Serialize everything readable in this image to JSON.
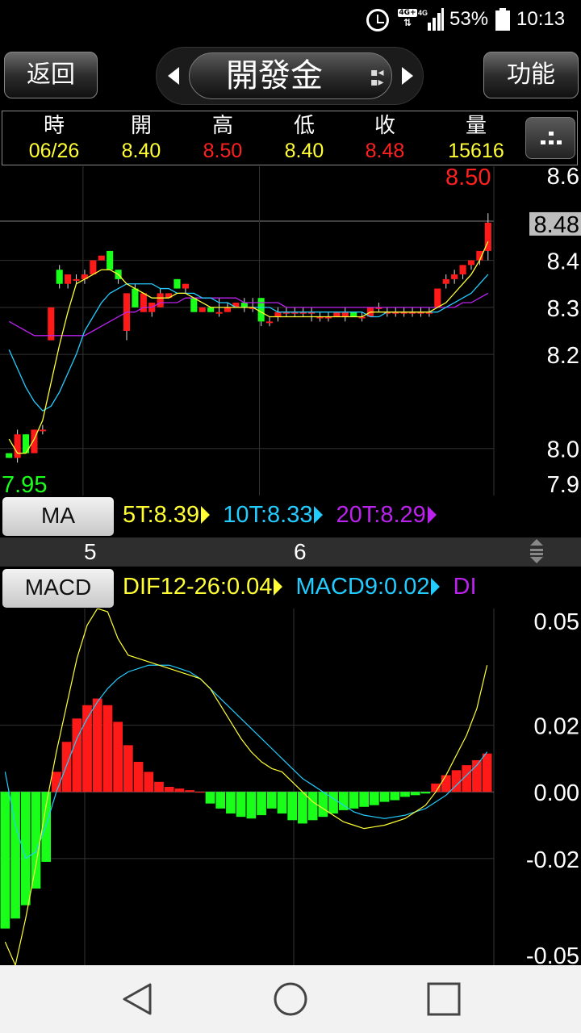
{
  "status_bar": {
    "network": "4G+",
    "network2": "4G",
    "battery": "53%",
    "time": "10:13",
    "icons": [
      "alarm-icon",
      "network-4g-icon",
      "signal-icon",
      "battery-icon"
    ]
  },
  "header": {
    "back_label": "返回",
    "title": "開發金",
    "function_label": "功能"
  },
  "quote": {
    "columns": [
      {
        "label": "時",
        "value": "06/26",
        "color": "#ffff33"
      },
      {
        "label": "開",
        "value": "8.40",
        "color": "#ffff33"
      },
      {
        "label": "高",
        "value": "8.50",
        "color": "#ff2020"
      },
      {
        "label": "低",
        "value": "8.40",
        "color": "#ffff33"
      },
      {
        "label": "收",
        "value": "8.48",
        "color": "#ff2020"
      },
      {
        "label": "量",
        "value": "15616",
        "color": "#ffff33"
      }
    ]
  },
  "ma_panel": {
    "button_label": "MA",
    "legend": [
      {
        "text": "5T:8.39",
        "color": "#ffff33"
      },
      {
        "text": "10T:8.33",
        "color": "#22ccff"
      },
      {
        "text": "20T:8.29",
        "color": "#bb22ee"
      }
    ]
  },
  "macd_panel": {
    "button_label": "MACD",
    "legend": [
      {
        "text": "DIF12-26:0.04",
        "color": "#ffff33"
      },
      {
        "text": "MACD9:0.02",
        "color": "#22ccff"
      },
      {
        "text": "DI",
        "color": "#bb22ee"
      }
    ]
  },
  "axis_dates": [
    "5",
    "6"
  ],
  "colors": {
    "up": "#ff1a1a",
    "down": "#1aff1a",
    "ma5": "#ffff33",
    "ma10": "#22ccff",
    "ma20": "#bb22ee"
  },
  "chart_data": [
    {
      "type": "candlestick",
      "title": "",
      "high_label": "8.50",
      "low_label": "7.95",
      "last_label": "8.48",
      "y_tick_labels": [
        "8.6",
        "8.4",
        "8.3",
        "8.2",
        "8.0",
        "7.9"
      ],
      "y_tick_values": [
        8.6,
        8.4,
        8.3,
        8.2,
        8.0,
        7.9
      ],
      "ylim": [
        7.9,
        8.6
      ],
      "x_labels": [
        "5",
        "6"
      ],
      "x_label_index": [
        8,
        29
      ],
      "candles": [
        [
          7.99,
          7.99,
          7.98,
          7.98
        ],
        [
          7.98,
          8.04,
          7.97,
          8.03
        ],
        [
          8.03,
          8.03,
          7.99,
          7.99
        ],
        [
          7.99,
          8.04,
          7.99,
          8.04
        ],
        [
          8.04,
          8.05,
          8.03,
          8.04
        ],
        [
          8.23,
          8.3,
          8.23,
          8.3
        ],
        [
          8.38,
          8.39,
          8.34,
          8.35
        ],
        [
          8.35,
          8.37,
          8.34,
          8.37
        ],
        [
          8.36,
          8.37,
          8.35,
          8.36
        ],
        [
          8.36,
          8.38,
          8.35,
          8.37
        ],
        [
          8.37,
          8.4,
          8.37,
          8.4
        ],
        [
          8.4,
          8.41,
          8.4,
          8.41
        ],
        [
          8.42,
          8.42,
          8.38,
          8.38
        ],
        [
          8.38,
          8.38,
          8.35,
          8.36
        ],
        [
          8.25,
          8.33,
          8.23,
          8.33
        ],
        [
          8.34,
          8.35,
          8.3,
          8.3
        ],
        [
          8.29,
          8.33,
          8.29,
          8.33
        ],
        [
          8.29,
          8.31,
          8.28,
          8.31
        ],
        [
          8.3,
          8.34,
          8.3,
          8.33
        ],
        [
          8.32,
          8.33,
          8.32,
          8.33
        ],
        [
          8.36,
          8.36,
          8.34,
          8.34
        ],
        [
          8.34,
          8.35,
          8.33,
          8.35
        ],
        [
          8.32,
          8.32,
          8.29,
          8.29
        ],
        [
          8.29,
          8.3,
          8.29,
          8.3
        ],
        [
          8.3,
          8.3,
          8.29,
          8.29
        ],
        [
          8.29,
          8.32,
          8.28,
          8.29
        ],
        [
          8.29,
          8.31,
          8.29,
          8.3
        ],
        [
          8.3,
          8.31,
          8.3,
          8.31
        ],
        [
          8.31,
          8.32,
          8.29,
          8.3
        ],
        [
          8.3,
          8.32,
          8.29,
          8.3
        ],
        [
          8.32,
          8.32,
          8.26,
          8.27
        ],
        [
          8.27,
          8.28,
          8.26,
          8.27
        ],
        [
          8.28,
          8.3,
          8.27,
          8.29
        ],
        [
          8.29,
          8.3,
          8.28,
          8.29
        ],
        [
          8.29,
          8.3,
          8.28,
          8.29
        ],
        [
          8.29,
          8.3,
          8.28,
          8.29
        ],
        [
          8.29,
          8.3,
          8.27,
          8.29
        ],
        [
          8.28,
          8.29,
          8.27,
          8.28
        ],
        [
          8.28,
          8.29,
          8.27,
          8.28
        ],
        [
          8.28,
          8.29,
          8.28,
          8.29
        ],
        [
          8.28,
          8.3,
          8.27,
          8.29
        ],
        [
          8.29,
          8.29,
          8.28,
          8.28
        ],
        [
          8.28,
          8.29,
          8.27,
          8.28
        ],
        [
          8.28,
          8.3,
          8.28,
          8.3
        ],
        [
          8.3,
          8.31,
          8.29,
          8.3
        ],
        [
          8.29,
          8.3,
          8.28,
          8.29
        ],
        [
          8.29,
          8.3,
          8.28,
          8.29
        ],
        [
          8.29,
          8.3,
          8.28,
          8.29
        ],
        [
          8.29,
          8.3,
          8.28,
          8.29
        ],
        [
          8.29,
          8.3,
          8.28,
          8.29
        ],
        [
          8.29,
          8.3,
          8.28,
          8.29
        ],
        [
          8.3,
          8.34,
          8.3,
          8.34
        ],
        [
          8.35,
          8.37,
          8.34,
          8.36
        ],
        [
          8.36,
          8.38,
          8.35,
          8.37
        ],
        [
          8.37,
          8.39,
          8.36,
          8.39
        ],
        [
          8.39,
          8.4,
          8.38,
          8.4
        ],
        [
          8.4,
          8.41,
          8.39,
          8.42
        ],
        [
          8.42,
          8.5,
          8.4,
          8.48
        ]
      ],
      "ma5": [
        8.02,
        7.99,
        7.99,
        8.02,
        8.06,
        8.14,
        8.22,
        8.29,
        8.35,
        8.36,
        8.37,
        8.38,
        8.38,
        8.37,
        8.35,
        8.34,
        8.33,
        8.32,
        8.32,
        8.32,
        8.33,
        8.33,
        8.32,
        8.31,
        8.3,
        8.3,
        8.3,
        8.3,
        8.3,
        8.3,
        8.29,
        8.28,
        8.28,
        8.28,
        8.28,
        8.28,
        8.28,
        8.28,
        8.28,
        8.28,
        8.28,
        8.28,
        8.28,
        8.29,
        8.29,
        8.29,
        8.29,
        8.29,
        8.29,
        8.29,
        8.29,
        8.3,
        8.31,
        8.33,
        8.35,
        8.37,
        8.4,
        8.44
      ],
      "ma10": [
        8.21,
        8.17,
        8.13,
        8.1,
        8.08,
        8.09,
        8.12,
        8.16,
        8.2,
        8.25,
        8.28,
        8.31,
        8.33,
        8.34,
        8.35,
        8.35,
        8.35,
        8.35,
        8.34,
        8.34,
        8.33,
        8.33,
        8.33,
        8.32,
        8.32,
        8.31,
        8.31,
        8.3,
        8.3,
        8.3,
        8.3,
        8.3,
        8.29,
        8.29,
        8.29,
        8.29,
        8.29,
        8.29,
        8.29,
        8.29,
        8.29,
        8.29,
        8.29,
        8.28,
        8.28,
        8.29,
        8.29,
        8.29,
        8.29,
        8.29,
        8.29,
        8.29,
        8.3,
        8.31,
        8.32,
        8.33,
        8.35,
        8.37
      ],
      "ma20": [
        8.27,
        8.26,
        8.25,
        8.24,
        8.24,
        8.24,
        8.24,
        8.24,
        8.24,
        8.24,
        8.25,
        8.26,
        8.27,
        8.28,
        8.29,
        8.29,
        8.3,
        8.3,
        8.31,
        8.31,
        8.31,
        8.32,
        8.32,
        8.32,
        8.32,
        8.32,
        8.32,
        8.32,
        8.31,
        8.31,
        8.31,
        8.31,
        8.31,
        8.3,
        8.3,
        8.3,
        8.3,
        8.3,
        8.3,
        8.3,
        8.3,
        8.3,
        8.3,
        8.3,
        8.3,
        8.3,
        8.3,
        8.3,
        8.3,
        8.3,
        8.3,
        8.3,
        8.3,
        8.3,
        8.31,
        8.31,
        8.32,
        8.33
      ]
    },
    {
      "type": "bar",
      "title": "",
      "y_tick_labels": [
        "0.05",
        "0.02",
        "0.00",
        "-0.02",
        "-0.05"
      ],
      "y_tick_values": [
        0.05,
        0.02,
        0.0,
        -0.02,
        -0.05
      ],
      "ylim": [
        -0.052,
        0.055
      ],
      "osc": [
        -0.041,
        -0.038,
        -0.034,
        -0.029,
        -0.021,
        0.006,
        0.015,
        0.022,
        0.026,
        0.028,
        0.026,
        0.021,
        0.014,
        0.009,
        0.006,
        0.003,
        0.0015,
        0.001,
        0.0005,
        0.0,
        -0.0035,
        -0.005,
        -0.0065,
        -0.0075,
        -0.008,
        -0.007,
        -0.005,
        -0.0065,
        -0.0085,
        -0.0095,
        -0.0085,
        -0.0075,
        -0.0065,
        -0.0055,
        -0.005,
        -0.0045,
        -0.004,
        -0.003,
        -0.0025,
        -0.0015,
        -0.001,
        -0.0005,
        0.0025,
        0.005,
        0.0065,
        0.008,
        0.0095,
        0.0115
      ],
      "dif": [
        -0.045,
        -0.052,
        -0.038,
        -0.022,
        -0.004,
        0.012,
        0.026,
        0.04,
        0.05,
        0.055,
        0.054,
        0.046,
        0.041,
        0.04,
        0.039,
        0.038,
        0.037,
        0.036,
        0.035,
        0.034,
        0.031,
        0.026,
        0.021,
        0.016,
        0.012,
        0.009,
        0.007,
        0.006,
        0.003,
        0.0,
        -0.003,
        -0.005,
        -0.007,
        -0.009,
        -0.01,
        -0.011,
        -0.0105,
        -0.01,
        -0.009,
        -0.008,
        -0.006,
        -0.004,
        0.0,
        0.005,
        0.011,
        0.017,
        0.025,
        0.038
      ],
      "macd": [
        0.006,
        -0.01,
        -0.02,
        -0.018,
        -0.01,
        0.0,
        0.008,
        0.016,
        0.022,
        0.027,
        0.031,
        0.034,
        0.036,
        0.037,
        0.038,
        0.038,
        0.038,
        0.037,
        0.036,
        0.034,
        0.031,
        0.028,
        0.025,
        0.022,
        0.019,
        0.016,
        0.013,
        0.01,
        0.007,
        0.004,
        0.002,
        0.0,
        -0.002,
        -0.004,
        -0.006,
        -0.007,
        -0.0075,
        -0.008,
        -0.0075,
        -0.007,
        -0.006,
        -0.005,
        -0.003,
        -0.001,
        0.002,
        0.005,
        0.008,
        0.012
      ]
    }
  ]
}
